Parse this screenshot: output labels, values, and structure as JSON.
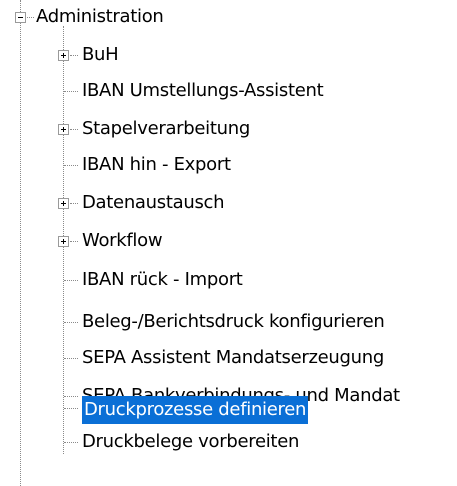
{
  "tree": {
    "root": {
      "label": "Administration",
      "expanded": true,
      "children": [
        {
          "label": "BuH",
          "expandable": true
        },
        {
          "label": "IBAN Umstellungs-Assistent",
          "expandable": false
        },
        {
          "label": "Stapelverarbeitung",
          "expandable": true
        },
        {
          "label": "IBAN hin - Export",
          "expandable": false
        },
        {
          "label": "Datenaustausch",
          "expandable": true
        },
        {
          "label": "Workflow",
          "expandable": true
        },
        {
          "label": "IBAN rück - Import",
          "expandable": false
        },
        {
          "label": "Beleg-/Berichtsdruck konfigurieren",
          "expandable": false
        },
        {
          "label": "SEPA Assistent Mandatserzeugung",
          "expandable": false
        },
        {
          "label": "SEPA Bankverbindungs- und Mandat",
          "expandable": false
        },
        {
          "label": "Druckprozesse definieren",
          "expandable": false,
          "selected": true
        },
        {
          "label": "Druckbelege vorbereiten",
          "expandable": false
        }
      ]
    },
    "colors": {
      "selection_bg": "#0a6fd6",
      "selection_fg": "#ffffff",
      "line": "#8a8a8a"
    }
  }
}
